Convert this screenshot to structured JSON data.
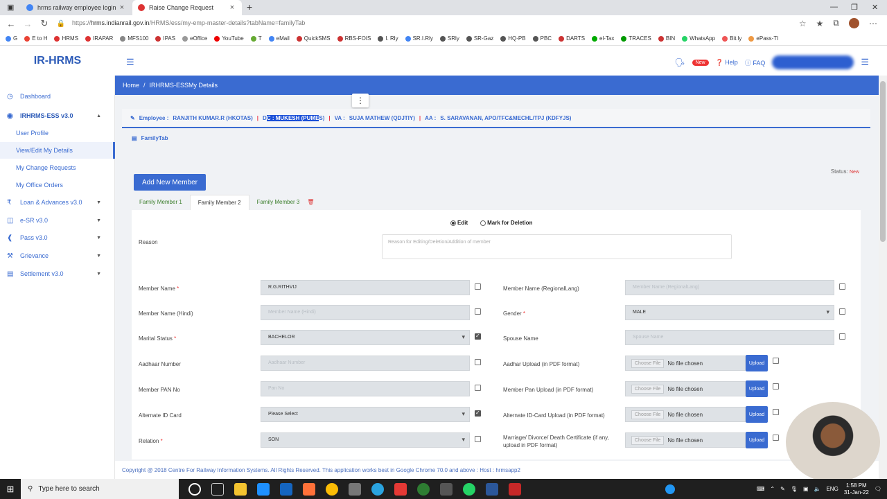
{
  "browser": {
    "tabs": [
      {
        "title": "hrms railway employee login - G",
        "active": false
      },
      {
        "title": "Raise Change Request",
        "active": true
      }
    ],
    "url_prefix": "https://",
    "url_host": "hrms.indianrail.gov.in",
    "url_path": "/HRMS/ess/my-emp-master-details?tabName=familyTab",
    "bookmarks": [
      "G",
      "E to H",
      "HRMS",
      "IRAPAR",
      "MFS100",
      "IPAS",
      "eOffice",
      "YouTube",
      "T",
      "eMail",
      "QuickSMS",
      "RBS-FOIS",
      "I. Rly",
      "SR.I.Rly",
      "SRly",
      "SR-Gaz",
      "HQ-PB",
      "PBC",
      "DARTS",
      "el-Tax",
      "TRACES",
      "BIN",
      "WhatsApp",
      "Bit.ly",
      "ePass-TI"
    ]
  },
  "header": {
    "logo": "IR-HRMS",
    "new_badge": "New",
    "help": "Help",
    "faq": "FAQ"
  },
  "sidebar": {
    "dashboard": "Dashboard",
    "ess": "IRHRMS-ESS v3.0",
    "sub_items": [
      "User Profile",
      "View/Edit My Details",
      "My Change Requests",
      "My Office Orders"
    ],
    "modules": [
      "Loan & Advances v3.0",
      "e-SR v3.0",
      "Pass v3.0",
      "Grievance",
      "Settlement v3.0"
    ]
  },
  "breadcrumb": {
    "home": "Home",
    "sep": "/",
    "current": "IRHRMS-ESSMy Details"
  },
  "approval": {
    "employee_label": "Employee :",
    "employee": "RANJITH KUMAR.R (HKOTAS)",
    "dc_label_a": "D",
    "dc_label_b": "C :",
    "dc_selected": "MUKESH (PUME",
    "dc_rest": "S)",
    "va_label": "VA :",
    "va": "SUJA MATHEW (QDJTIY)",
    "aa_label": "AA :",
    "aa": "S. SARAVANAN, APO/TFC&MECHL/TPJ (KDFYJS)",
    "separator": "|"
  },
  "family_tab_label": "FamilyTab",
  "add_member_button": "Add New Member",
  "status_label": "Status:",
  "status_value": "New",
  "member_tabs": [
    "Family Member 1",
    "Family Member 2",
    "Family Member 3"
  ],
  "active_member_tab": 1,
  "form": {
    "edit_label": "Edit",
    "delete_label": "Mark for Deletion",
    "reason_label": "Reason",
    "reason_placeholder": "Reason for Editing/Deletion/Addition of member",
    "left": [
      {
        "label": "Member Name",
        "required": true,
        "value": "R.G.RITHVIJ",
        "placeholder": "",
        "type": "text",
        "checked": false
      },
      {
        "label": "Member Name (Hindi)",
        "required": false,
        "value": "",
        "placeholder": "Member Name (Hindi)",
        "type": "text",
        "checked": false
      },
      {
        "label": "Marital Status",
        "required": true,
        "value": "BACHELOR",
        "placeholder": "",
        "type": "select",
        "checked": true
      },
      {
        "label": "Aadhaar Number",
        "required": false,
        "value": "",
        "placeholder": "Aadhaar Number",
        "type": "text",
        "checked": false
      },
      {
        "label": "Member PAN No",
        "required": false,
        "value": "",
        "placeholder": "Pan No",
        "type": "text",
        "checked": false
      },
      {
        "label": "Alternate ID Card",
        "required": false,
        "value": "Please Select",
        "placeholder": "",
        "type": "select",
        "checked": true
      },
      {
        "label": "Relation",
        "required": true,
        "value": "SON",
        "placeholder": "",
        "type": "select",
        "checked": false
      }
    ],
    "right_top": [
      {
        "label": "Member Name (RegionalLang)",
        "required": false,
        "value": "",
        "placeholder": "Member Name (RegionalLang)",
        "type": "text"
      },
      {
        "label": "Gender",
        "required": true,
        "value": "MALE",
        "placeholder": "",
        "type": "select"
      },
      {
        "label": "Spouse Name",
        "required": false,
        "value": "",
        "placeholder": "Spouse Name",
        "type": "text"
      }
    ],
    "right_files": [
      {
        "label": "Aadhar Upload (in PDF format)"
      },
      {
        "label": "Member Pan Upload (in PDF format)"
      },
      {
        "label": "Alternate ID-Card Upload (in PDF format)"
      },
      {
        "label": "Marriage/ Divorce/ Death Certificate (if any, upload in PDF format)"
      }
    ],
    "choose_file": "Choose File",
    "no_file": "No file chosen",
    "upload": "Upload"
  },
  "footer": "Copyright @ 2018 Centre For Railway Information Systems. All Rights Reserved. This application works best in Google Chrome 70.0 and above : Host : hrmsapp2",
  "taskbar": {
    "search_placeholder": "Type here to search",
    "lang": "ENG",
    "time": "1:58 PM",
    "date": "31-Jan-22"
  }
}
